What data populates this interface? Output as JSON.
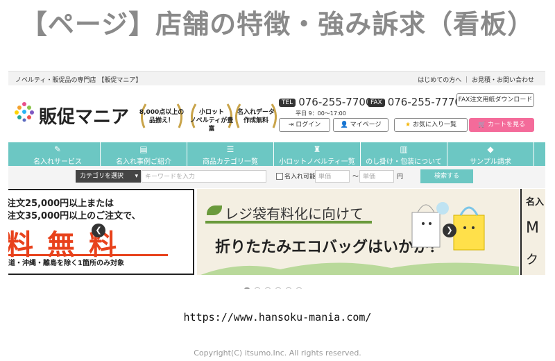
{
  "slide": {
    "title": "【ページ】店舗の特徴・強み訴求（看板）",
    "url": "https://www.hansoku-mania.com/",
    "copyright": "Copyright(C)  itsumo.Inc. All rights reserved."
  },
  "site": {
    "topbar": {
      "left": "ノベルティ・販促品の専門店 【販促マニア】",
      "right": "はじめての方へ ｜ お見積・お問い合わせ"
    },
    "logo_text": "販促マニア",
    "badges": [
      {
        "line1": "8,000点以上の",
        "line2": "品揃え！"
      },
      {
        "line1": "小ロット",
        "line2": "ノベルティが豊富"
      },
      {
        "line1": "名入れデータ",
        "line2": "作成無料"
      }
    ],
    "tel_label": "TEL",
    "tel": "076-255-7700",
    "hours": "平日 9：00～17:00",
    "fax_label": "FAX",
    "fax": "076-255-7770",
    "fax_download": "FAX注文用紙ダウンロード",
    "buttons": {
      "login": "ログイン",
      "mypage": "マイページ",
      "favorites": "お気に入り一覧",
      "cart": "カートを見る"
    },
    "nav": [
      {
        "label": "名入れサービス",
        "icon": "brush-icon"
      },
      {
        "label": "名入れ事例ご紹介",
        "icon": "document-icon"
      },
      {
        "label": "商品カテゴリ一覧",
        "icon": "list-icon"
      },
      {
        "label": "小ロットノベルティ一覧",
        "icon": "tshirt-icon"
      },
      {
        "label": "のし掛け・包装について",
        "icon": "gift-icon"
      },
      {
        "label": "サンプル請求",
        "icon": "box-icon"
      }
    ],
    "search": {
      "category": "カテゴリを選択",
      "keyword_placeholder": "キーワードを入力",
      "nameable_label": "名入れ可能",
      "price_min_placeholder": "単価",
      "price_max_placeholder": "単価",
      "range_sep": "～",
      "yen": "円",
      "submit": "検索する"
    },
    "banners": {
      "left_line1": "注文25,000円以上または",
      "left_line2": "注文35,000円以上のご注文で、",
      "left_big": "料無料",
      "left_note": "道・沖縄・離島を除く1箇所のみ対象",
      "mid_line1": "レジ袋有料化に向けて",
      "mid_line2": "折りたたみエコバッグはいかが？",
      "right_top": "名入",
      "right_mid": "M",
      "right_bottom": "ク"
    },
    "carousel_total_dots": 6,
    "carousel_active_index": 0
  }
}
